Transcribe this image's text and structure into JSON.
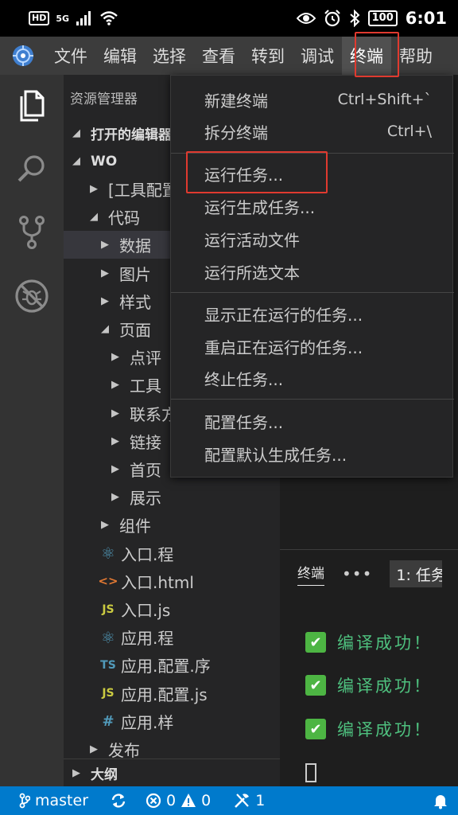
{
  "status_bar": {
    "time": "6:01",
    "network": "5G",
    "hd": "HD",
    "battery": "100"
  },
  "menubar": {
    "items": [
      "文件",
      "编辑",
      "选择",
      "查看",
      "转到",
      "调试",
      "终端",
      "帮助"
    ],
    "active_index": 6
  },
  "explorer": {
    "title": "资源管理器",
    "open_editors": "打开的编辑器",
    "workspace": "WO",
    "tree": [
      {
        "label": "[工具配置",
        "twisty": "closed",
        "icon": "",
        "indent": 1
      },
      {
        "label": "代码",
        "twisty": "open",
        "icon": "",
        "indent": 1
      },
      {
        "label": "数据",
        "twisty": "closed",
        "icon": "",
        "indent": 2,
        "selected": true
      },
      {
        "label": "图片",
        "twisty": "closed",
        "icon": "",
        "indent": 2
      },
      {
        "label": "样式",
        "twisty": "closed",
        "icon": "",
        "indent": 2
      },
      {
        "label": "页面",
        "twisty": "open",
        "icon": "",
        "indent": 2
      },
      {
        "label": "点评",
        "twisty": "closed",
        "icon": "",
        "indent": 3
      },
      {
        "label": "工具",
        "twisty": "closed",
        "icon": "",
        "indent": 3
      },
      {
        "label": "联系方",
        "twisty": "closed",
        "icon": "",
        "indent": 3
      },
      {
        "label": "链接",
        "twisty": "closed",
        "icon": "",
        "indent": 3
      },
      {
        "label": "首页",
        "twisty": "closed",
        "icon": "",
        "indent": 3
      },
      {
        "label": "展示",
        "twisty": "closed",
        "icon": "",
        "indent": 3
      },
      {
        "label": "组件",
        "twisty": "closed",
        "icon": "",
        "indent": 2
      },
      {
        "label": "入口.程",
        "twisty": "",
        "icon": "react",
        "indent": 2
      },
      {
        "label": "入口.html",
        "twisty": "",
        "icon": "html",
        "indent": 2
      },
      {
        "label": "入口.js",
        "twisty": "",
        "icon": "js",
        "indent": 2
      },
      {
        "label": "应用.程",
        "twisty": "",
        "icon": "react",
        "indent": 2
      },
      {
        "label": "应用.配置.序",
        "twisty": "",
        "icon": "ts",
        "indent": 2
      },
      {
        "label": "应用.配置.js",
        "twisty": "",
        "icon": "js",
        "indent": 2
      },
      {
        "label": "应用.样",
        "twisty": "",
        "icon": "css",
        "indent": 2
      },
      {
        "label": "发布",
        "twisty": "closed",
        "icon": "",
        "indent": 1
      }
    ],
    "outline": "大纲"
  },
  "terminal_menu": {
    "groups": [
      [
        {
          "label": "新建终端",
          "shortcut": "Ctrl+Shift+`"
        },
        {
          "label": "拆分终端",
          "shortcut": "Ctrl+\\"
        }
      ],
      [
        {
          "label": "运行任务...",
          "shortcut": ""
        },
        {
          "label": "运行生成任务...",
          "shortcut": ""
        },
        {
          "label": "运行活动文件",
          "shortcut": ""
        },
        {
          "label": "运行所选文本",
          "shortcut": ""
        }
      ],
      [
        {
          "label": "显示正在运行的任务...",
          "shortcut": ""
        },
        {
          "label": "重启正在运行的任务...",
          "shortcut": ""
        },
        {
          "label": "终止任务...",
          "shortcut": ""
        }
      ],
      [
        {
          "label": "配置任务...",
          "shortcut": ""
        },
        {
          "label": "配置默认生成任务...",
          "shortcut": ""
        }
      ]
    ]
  },
  "terminal_panel": {
    "tab": "终端",
    "more": "•••",
    "select": "1: 任务",
    "lines": [
      "编译成功！",
      "编译成功！",
      "编译成功！"
    ],
    "check": "✔"
  },
  "vscode_status": {
    "branch": "master",
    "errors": "0",
    "warnings": "0",
    "tools": "1"
  },
  "colors": {
    "accent": "#007acc",
    "highlight": "#e03a2f",
    "success": "#4ec07e"
  }
}
